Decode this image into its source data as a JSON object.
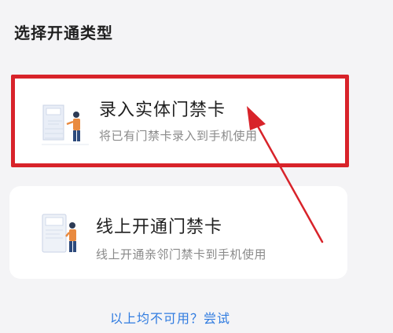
{
  "page": {
    "title": "选择开通类型"
  },
  "options": [
    {
      "title": "录入实体门禁卡",
      "subtitle": "将已有门禁卡录入到手机使用",
      "highlighted": true
    },
    {
      "title": "线上开通门禁卡",
      "subtitle": "线上开通亲邻门禁卡到手机使用",
      "highlighted": false
    }
  ],
  "footer": {
    "link_text": "以上均不可用？尝试"
  },
  "colors": {
    "highlight_border": "#d8232a",
    "link": "#2f7be0",
    "arrow": "#d8232a"
  },
  "icons": {
    "option_1": "person-with-card-reader-illustration",
    "option_2": "person-with-phone-illustration",
    "annotation": "red-arrow-pointer"
  }
}
